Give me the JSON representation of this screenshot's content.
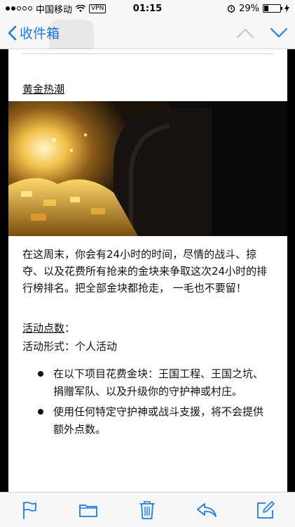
{
  "status_bar": {
    "carrier": "中国移动",
    "vpn": "VPN",
    "time": "01:15",
    "battery_text": "29%",
    "battery_level": 0.29
  },
  "nav": {
    "back_label": "收件箱"
  },
  "email": {
    "headline": "黄金热潮",
    "paragraph": "在这周末，你会有24小时的时间，尽情的战斗、掠夺、以及花费所有抢来的金块来争取这次24小时的排行榜排名。把全部金块都抢走， 一毛也不要留！",
    "points_label": "活动点数",
    "points_suffix": "：",
    "format_line": "活动形式：个人活动",
    "bullets": [
      "在以下项目花费金块：王国工程、王国之坑、捐赠军队、以及升级你的守护神或村庄。",
      "使用任何特定守护神或战斗支援，将不会提供额外点数。"
    ]
  },
  "colors": {
    "accent": "#1a7cf5"
  },
  "toolbar": {
    "icons": [
      "flag-icon",
      "folder-icon",
      "trash-icon",
      "reply-icon",
      "compose-icon"
    ]
  }
}
